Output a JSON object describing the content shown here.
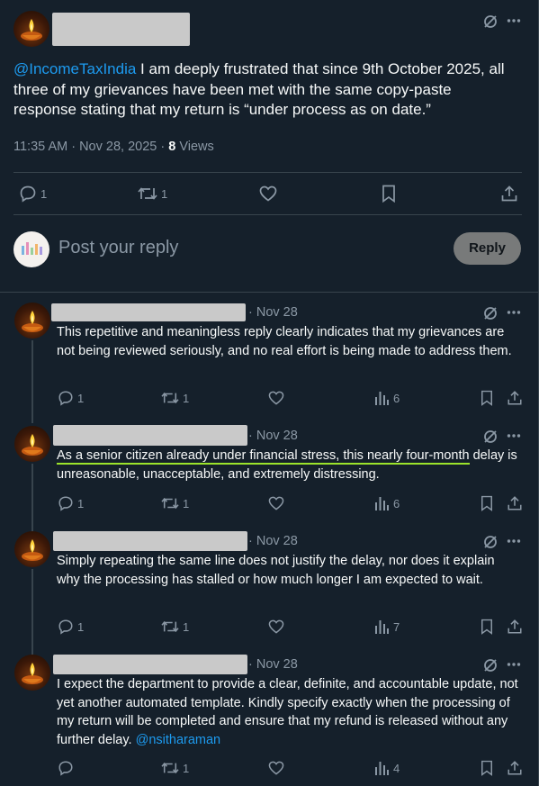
{
  "post": {
    "mention": "@IncomeTaxIndia",
    "text": " I am deeply frustrated that since 9th October 2025, all three of my grievances have been met with the same copy-paste response stating that my return is “under process as on date.”",
    "time": "11:35 AM · Nov 28, 2025 · ",
    "views_count": "8",
    "views_label": " Views",
    "replies": "1",
    "reposts": "1"
  },
  "composer": {
    "placeholder": "Post your reply",
    "button": "Reply"
  },
  "replies": [
    {
      "date": "· Nov 28",
      "text": "This repetitive and meaningless reply clearly indicates that my grievances are not being reviewed seriously, and no real effort is being made to address them.",
      "replies": "1",
      "reposts": "1",
      "views": "6"
    },
    {
      "date": "· Nov 28",
      "text_highlight": "As a senior citizen already under financial stress, this nearly four-month",
      "text": " delay is unreasonable, unacceptable, and extremely distressing.",
      "replies": "1",
      "reposts": "1",
      "views": "6"
    },
    {
      "date": "· Nov 28",
      "text": "Simply repeating the same line does not justify the delay, nor does it explain why the processing has stalled or how much longer I am expected to wait.",
      "replies": "1",
      "reposts": "1",
      "views": "7"
    },
    {
      "date": "· Nov 28",
      "text": "I expect the department to provide a clear, definite, and accountable update, not yet another automated template. Kindly specify exactly when the processing of my return will be completed and ensure that my refund is released without any further delay. ",
      "mention": "@nsitharaman",
      "replies": "",
      "reposts": "1",
      "views": "4"
    }
  ],
  "colors": {
    "background": "#15202b",
    "accent": "#1d9bf0",
    "muted": "#8b98a5",
    "highlight": "#9be32b"
  }
}
